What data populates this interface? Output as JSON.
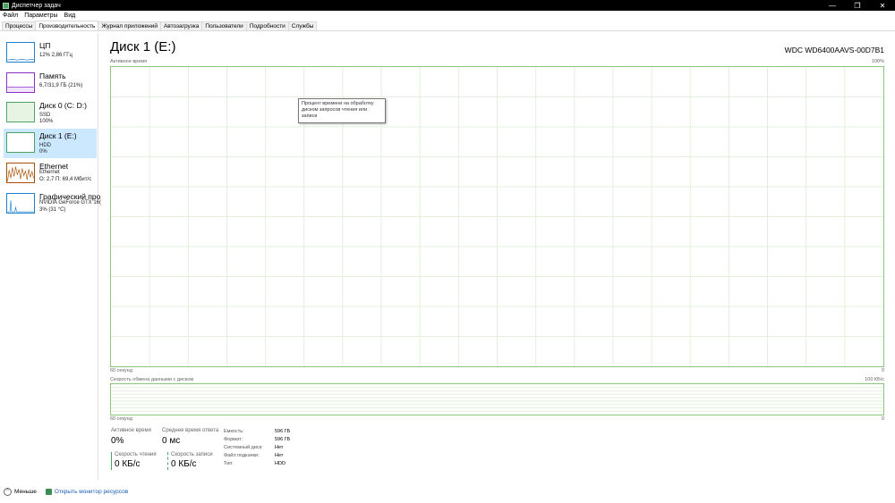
{
  "window": {
    "title": "Диспетчер задач",
    "controls": [
      "—",
      "❐",
      "✕"
    ]
  },
  "menu": [
    "Файл",
    "Параметры",
    "Вид"
  ],
  "tabs": [
    {
      "label": "Процессы",
      "active": false
    },
    {
      "label": "Производительность",
      "active": true
    },
    {
      "label": "Журнал приложений",
      "active": false
    },
    {
      "label": "Автозагрузка",
      "active": false
    },
    {
      "label": "Пользователи",
      "active": false
    },
    {
      "label": "Подробности",
      "active": false
    },
    {
      "label": "Службы",
      "active": false
    }
  ],
  "sidebar": {
    "items": [
      {
        "name": "ЦП",
        "sub1": "12% 2,86 ГГц",
        "sub2": "",
        "color": "#1e7fcc"
      },
      {
        "name": "Память",
        "sub1": "6,7/31,9 ГБ (21%)",
        "sub2": "",
        "color": "#8b2fc9"
      },
      {
        "name": "Диск 0 (C: D:)",
        "sub1": "SSD",
        "sub2": "100%",
        "color": "#4aa564"
      },
      {
        "name": "Диск 1 (E:)",
        "sub1": "HDD",
        "sub2": "0%",
        "color": "#4aa564"
      },
      {
        "name": "Ethernet",
        "sub1": "Ethernet",
        "sub2": "О: 2,7 П: 69,4 Мбит/с",
        "color": "#a74f01"
      },
      {
        "name": "Графический про",
        "sub1": "NVIDIA GeForce GTX 16(",
        "sub2": "3% (31 °C)",
        "color": "#1e7fcc"
      }
    ]
  },
  "main": {
    "title": "Диск 1 (E:)",
    "model": "WDC WD6400AAVS-00D7B1",
    "active_graph": {
      "label": "Активное время",
      "max": "100%",
      "x_left": "60 секунд",
      "x_right": "0"
    },
    "tooltip": "Процент времени на обработку диском запросов чтения или записи",
    "transfer_graph": {
      "label": "Скорость обмена данными с диском",
      "max": "100 КБ/с",
      "x_left": "60 секунд",
      "x_right": "0"
    },
    "stats": {
      "active_time_label": "Активное время",
      "active_time_value": "0%",
      "avg_response_label": "Среднее время ответа",
      "avg_response_value": "0 мс",
      "read_label": "Скорость чтения",
      "read_value": "0 КБ/с",
      "write_label": "Скорость записи",
      "write_value": "0 КБ/с"
    },
    "info": [
      {
        "label": "Емкость:",
        "value": "596 ГБ"
      },
      {
        "label": "Формат:",
        "value": "596 ГБ"
      },
      {
        "label": "Системный диск:",
        "value": "Нет"
      },
      {
        "label": "Файл подкачки:",
        "value": "Нет"
      },
      {
        "label": "Тип:",
        "value": "HDD"
      }
    ]
  },
  "footer": {
    "less_label": "Меньше",
    "monitor_label": "Открыть монитор ресурсов"
  }
}
